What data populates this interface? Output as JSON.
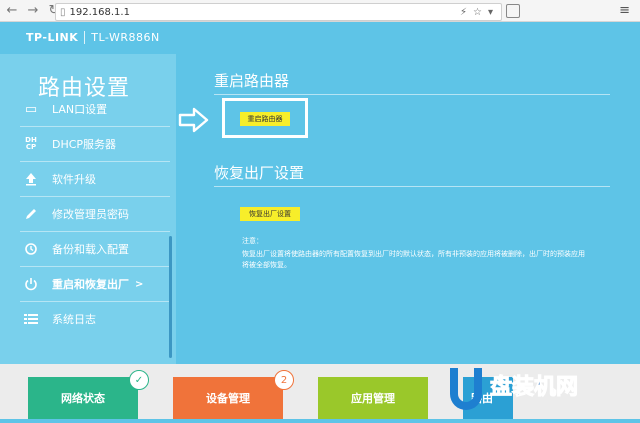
{
  "browser": {
    "back_icon": "back-arrow-icon",
    "forward_icon": "forward-arrow-icon",
    "refresh_icon": "refresh-icon",
    "url": "192.168.1.1"
  },
  "header": {
    "brand": "TP-LINK",
    "model": "TL-WR886N"
  },
  "sidebar": {
    "title": "路由设置",
    "items": [
      {
        "label": "LAN口设置",
        "icon": "lan-icon"
      },
      {
        "label": "DHCP服务器",
        "icon": "dhcp-icon",
        "icon_text": "DH CP"
      },
      {
        "label": "软件升级",
        "icon": "upload-icon"
      },
      {
        "label": "修改管理员密码",
        "icon": "pencil-icon"
      },
      {
        "label": "备份和载入配置",
        "icon": "backup-icon"
      },
      {
        "label": "重启和恢复出厂",
        "icon": "power-icon",
        "chevron": ">"
      },
      {
        "label": "系统日志",
        "icon": "list-icon"
      }
    ]
  },
  "main": {
    "reboot": {
      "title": "重启路由器",
      "button": "重启路由器"
    },
    "factory": {
      "title": "恢复出厂设置",
      "button": "恢复出厂设置",
      "note_title": "注意：",
      "note_line1": "恢复出厂设置将使路由器的所有配置恢复到出厂时的默认状态，所有非预装的应用将被删除，出厂时的预装应用",
      "note_line2": "将被全部恢复。"
    }
  },
  "bottom": {
    "tiles": [
      {
        "label": "网络状态",
        "color": "#2bb58a",
        "badge": "✓"
      },
      {
        "label": "设备管理",
        "color": "#f0733a",
        "badge": "2"
      },
      {
        "label": "应用管理",
        "color": "#9ac82a"
      },
      {
        "label": "路由",
        "color": "#2ba0d4"
      }
    ]
  },
  "watermark": {
    "letter": "U",
    "text": "盘装机网"
  },
  "colors": {
    "background": "#5ec4e7",
    "sidebar": "#79d0ec",
    "button_yellow": "#f7ee2a"
  }
}
